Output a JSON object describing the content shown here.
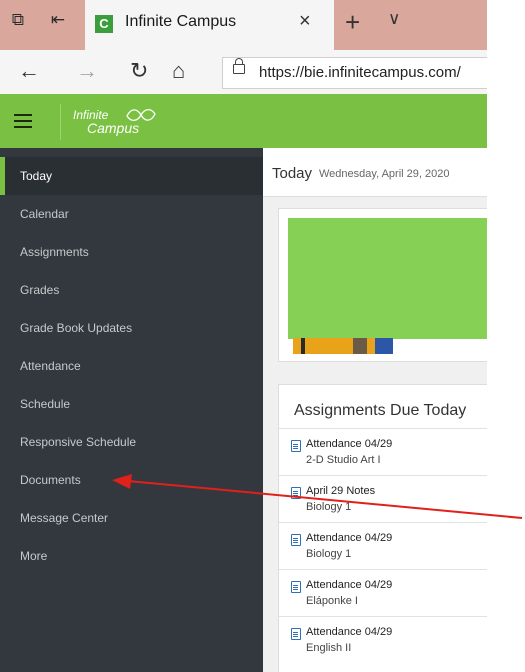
{
  "browser": {
    "tab_title": "Infinite Campus",
    "favicon_letter": "C",
    "url": "https://bie.infinitecampus.com/"
  },
  "app": {
    "logo_line1": "Infinite",
    "logo_line2": "Campus",
    "brand_color": "#7ac143"
  },
  "sidebar": {
    "items": [
      {
        "label": "Today",
        "active": true
      },
      {
        "label": "Calendar"
      },
      {
        "label": "Assignments"
      },
      {
        "label": "Grades"
      },
      {
        "label": "Grade Book Updates"
      },
      {
        "label": "Attendance"
      },
      {
        "label": "Schedule"
      },
      {
        "label": "Responsive Schedule"
      },
      {
        "label": "Documents"
      },
      {
        "label": "Message Center"
      },
      {
        "label": "More"
      }
    ]
  },
  "main": {
    "title": "Today",
    "date": "Wednesday, April 29, 2020",
    "assignments_card_title": "Assignments Due Today",
    "assignments": [
      {
        "name": "Attendance 04/29",
        "course": "2-D Studio Art I"
      },
      {
        "name": "April 29 Notes",
        "course": "Biology 1"
      },
      {
        "name": "Attendance 04/29",
        "course": "Biology 1"
      },
      {
        "name": "Attendance 04/29",
        "course": "Eláponke I"
      },
      {
        "name": "Attendance 04/29",
        "course": "English II"
      }
    ]
  },
  "annotation": {
    "arrow_color": "#e0201b"
  }
}
